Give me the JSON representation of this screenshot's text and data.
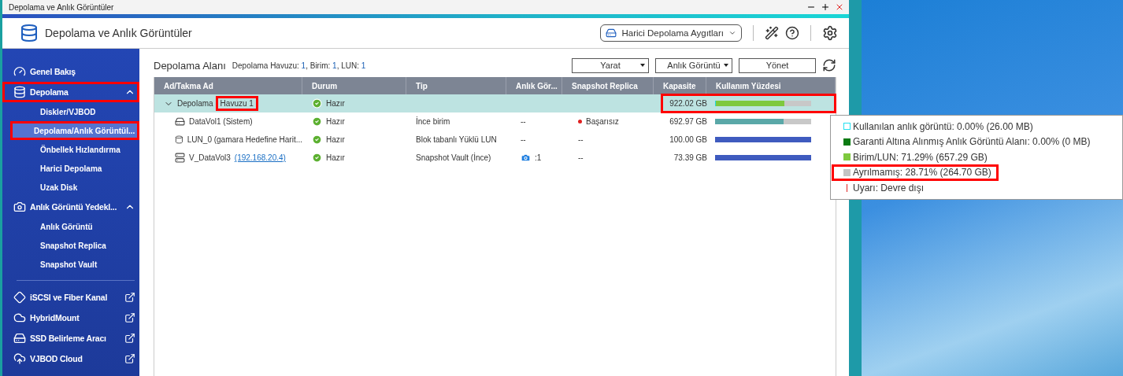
{
  "window": {
    "title": "Depolama ve Anlık Görüntüler"
  },
  "header": {
    "app_title": "Depolama ve Anlık Görüntüler",
    "device_menu": "Harici Depolama Aygıtları"
  },
  "sidebar": {
    "items": [
      {
        "kind": "group",
        "label": "Genel Bakış",
        "selected": false,
        "highlighted": false
      },
      {
        "kind": "group",
        "label": "Depolama",
        "selected": false,
        "highlighted": true,
        "expanded": true,
        "children": [
          {
            "label": "Diskler/VJBOD",
            "selected": false,
            "highlighted": false
          },
          {
            "label": "Depolama/Anlık Görüntül...",
            "selected": true,
            "highlighted": true
          },
          {
            "label": "Önbellek Hızlandırma",
            "selected": false,
            "highlighted": false
          },
          {
            "label": "Harici Depolama",
            "selected": false,
            "highlighted": false
          },
          {
            "label": "Uzak Disk",
            "selected": false,
            "highlighted": false
          }
        ]
      },
      {
        "kind": "group",
        "label": "Anlık Görüntü Yedekl...",
        "selected": false,
        "highlighted": false,
        "expanded": true,
        "children": [
          {
            "label": "Anlık Görüntü",
            "selected": false,
            "highlighted": false
          },
          {
            "label": "Snapshot Replica",
            "selected": false,
            "highlighted": false
          },
          {
            "label": "Snapshot Vault",
            "selected": false,
            "highlighted": false
          }
        ]
      },
      {
        "kind": "divider"
      },
      {
        "kind": "external",
        "label": "iSCSI ve Fiber Kanal",
        "selected": false,
        "highlighted": false
      },
      {
        "kind": "external",
        "label": "HybridMount",
        "selected": false,
        "highlighted": false
      },
      {
        "kind": "external",
        "label": "SSD Belirleme Aracı",
        "selected": false,
        "highlighted": false
      },
      {
        "kind": "external",
        "label": "VJBOD Cloud",
        "selected": false,
        "highlighted": false
      }
    ]
  },
  "content": {
    "title": "Depolama Alanı",
    "summary": [
      {
        "label": "Depolama Havuzu: ",
        "value": "1"
      },
      {
        "label": ", Birim: ",
        "value": "1"
      },
      {
        "label": ", LUN: ",
        "value": "1"
      }
    ],
    "buttons": [
      {
        "label": "Yarat",
        "dropdown": true
      },
      {
        "label": "Anlık Görüntü",
        "dropdown": true
      },
      {
        "label": "Yönet",
        "dropdown": false
      }
    ]
  },
  "table": {
    "columns": [
      "Ad/Takma Ad",
      "Durum",
      "Tip",
      "Anlık Gör...",
      "Snapshot Replica",
      "Kapasite",
      "Kullanım Yüzdesi"
    ],
    "rows": [
      {
        "kind": "pool",
        "name": "Depolama",
        "name_tail": "Havuzu 1",
        "tail_highlighted": true,
        "expanded": true,
        "selected": true,
        "status": "Hazır",
        "capacity": "922.02 GB",
        "capacity_highlighted": true,
        "usage": [
          {
            "color": "#22d8e0",
            "level": 0.01
          },
          {
            "color": "#7ec93e",
            "level": 0.7129
          }
        ],
        "children": [
          {
            "kind": "volume",
            "name": "DataVol1 (Sistem)",
            "selected": false,
            "status": "Hazır",
            "type": "İnce birim",
            "snapshots": {
              "text": "--"
            },
            "replica": {
              "text": "Başarısız",
              "failed": true
            },
            "capacity": "692.97 GB",
            "usage": [
              {
                "color": "#5aa8a8",
                "level": 0.71
              }
            ]
          },
          {
            "kind": "lun",
            "name": "LUN_0 (gamara Hedefine Harit...",
            "selected": false,
            "status": "Hazır",
            "type": "Blok tabanlı Yüklü LUN",
            "snapshots": {
              "text": "--"
            },
            "replica": {
              "text": "--",
              "failed": false
            },
            "capacity": "100.00 GB",
            "usage": [
              {
                "color": "#3f5bbf",
                "level": 1
              }
            ]
          },
          {
            "kind": "vault",
            "name": "V_DataVol3",
            "link": "(192.168.20.4)",
            "selected": false,
            "status": "Hazır",
            "type": "Snapshot Vault (İnce)",
            "snapshots": {
              "text": ":1",
              "icon": true
            },
            "replica": {
              "text": "--",
              "failed": false
            },
            "capacity": "73.39 GB",
            "usage": [
              {
                "color": "#3f5bbf",
                "level": 1
              }
            ]
          }
        ]
      }
    ]
  },
  "tooltip": {
    "items": [
      {
        "kind": "outline",
        "color": "#22e0f0",
        "text": "Kullanılan anlık görüntü: 0.00% (26.00 MB)",
        "highlighted": false
      },
      {
        "kind": "fill",
        "color": "#0a7a12",
        "text": "Garanti Altına Alınmış Anlık Görüntü Alanı: 0.00% (0 MB)",
        "highlighted": false
      },
      {
        "kind": "fill",
        "color": "#7ec93e",
        "text": "Birim/LUN: 71.29% (657.29 GB)",
        "highlighted": false
      },
      {
        "kind": "fill",
        "color": "#c4c4c4",
        "text": "Ayrılmamış: 28.71% (264.70 GB)",
        "highlighted": true
      },
      {
        "kind": "line",
        "color": "#e02020",
        "text": "Uyarı: Devre dışı",
        "highlighted": false
      }
    ]
  }
}
